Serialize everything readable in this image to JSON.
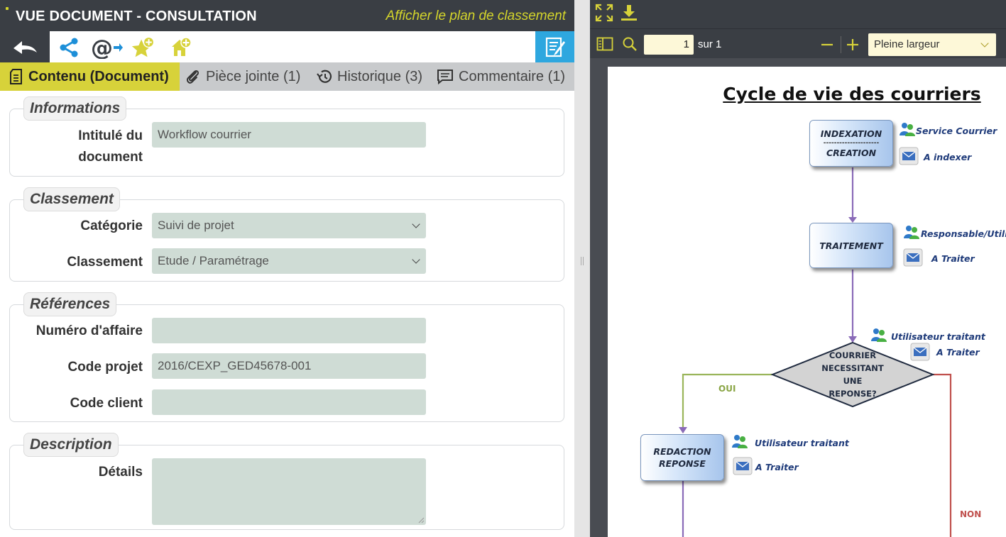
{
  "left": {
    "title": "VUE DOCUMENT - CONSULTATION",
    "plan_link": "Afficher le plan de classement",
    "tabs": [
      {
        "label": "Contenu (Document)"
      },
      {
        "label": "Pièce jointe (1)"
      },
      {
        "label": "Historique (3)"
      },
      {
        "label": "Commentaire (1)"
      }
    ],
    "sections": {
      "informations": {
        "legend": "Informations",
        "intitule_label_1": "Intitulé du",
        "intitule_label_2": "document",
        "intitule_value": "Workflow courrier"
      },
      "classement": {
        "legend": "Classement",
        "categorie_label": "Catégorie",
        "categorie_value": "Suivi de projet",
        "classement_label": "Classement",
        "classement_value": "Etude / Paramétrage"
      },
      "references": {
        "legend": "Références",
        "numero_label": "Numéro d'affaire",
        "numero_value": "",
        "code_projet_label": "Code projet",
        "code_projet_value": "2016/CEXP_GED45678-001",
        "code_client_label": "Code client",
        "code_client_value": ""
      },
      "description": {
        "legend": "Description",
        "details_label": "Détails",
        "details_value": ""
      }
    },
    "icons": {
      "back": "back-arrow-icon",
      "share": "share-icon",
      "email": "email-at-icon",
      "favorite": "star-add-icon",
      "home": "home-add-icon",
      "notes": "notes-icon"
    },
    "colors": {
      "dark_bar": "#3a3e44",
      "accent_yellow": "#d7d23a",
      "notes_blue": "#2ea7df",
      "field_bg": "#cfdcd5"
    }
  },
  "viewer": {
    "page_current": "1",
    "page_total_label": "sur 1",
    "zoom": "Pleine largeur",
    "icons": {
      "fullscreen": "fullscreen-icon",
      "download": "download-icon",
      "sidebar": "sidebar-toggle-icon",
      "search": "search-icon",
      "zoom_out": "minus-icon",
      "zoom_in": "plus-icon"
    },
    "document": {
      "title": "Cycle de vie des courriers",
      "nodes": {
        "indexation_1": "INDEXATION",
        "indexation_sep": "---------------------",
        "indexation_2": "CREATION",
        "traitement": "TRAITEMENT",
        "decision_1": "COURRIER",
        "decision_2": "NECESSITANT",
        "decision_3": "UNE",
        "decision_4": "REPONSE?",
        "redaction_1": "REDACTION",
        "redaction_2": "REPONSE"
      },
      "annotations": {
        "a1_user": "Service Courrier",
        "a1_mail": "A indexer",
        "a2_user": "Responsable/Utilis",
        "a2_mail": "A Traiter",
        "a3_user": "Utilisateur traitant",
        "a3_mail": "A Traiter",
        "a4_user": "Utilisateur traitant",
        "a4_mail": "A Traiter"
      },
      "edge_labels": {
        "oui": "OUI",
        "non": "NON"
      }
    }
  }
}
